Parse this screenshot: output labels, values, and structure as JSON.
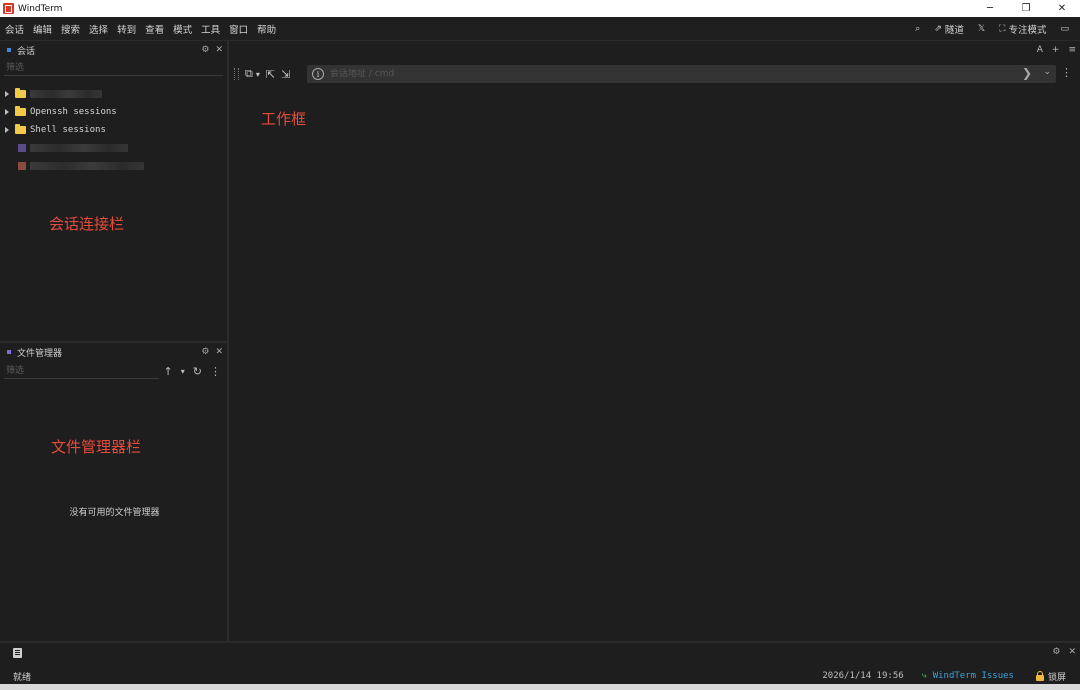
{
  "window": {
    "title": "WindTerm",
    "minimize": "─",
    "restore": "❐",
    "close": "✕"
  },
  "menubar": {
    "items": [
      "会话",
      "编辑",
      "搜索",
      "选择",
      "转到",
      "查看",
      "模式",
      "工具",
      "窗口",
      "帮助"
    ],
    "right": {
      "search_icon": "⌕",
      "tunnel_icon": "⇗",
      "tunnel": "隧道",
      "x": "𝕏",
      "focus_icon": "⛶",
      "focus": "专注模式",
      "layout_icon": "▭"
    }
  },
  "sessions_panel": {
    "title": "会话",
    "gear": "⚙",
    "close": "✕",
    "filter_placeholder": "筛选",
    "folders": [
      "",
      "Openssh sessions",
      "Shell sessions"
    ],
    "session_colors": [
      "#5a4b8a",
      "#8a4b3a"
    ]
  },
  "files_panel": {
    "title": "文件管理器",
    "gear": "⚙",
    "close": "✕",
    "filter_placeholder": "筛选",
    "up": "↑",
    "dropdown": "▾",
    "refresh": "↻",
    "more": "⋮",
    "empty": "没有可用的文件管理器"
  },
  "annotations": {
    "session_bar": "会话连接栏",
    "file_bar": "文件管理器栏",
    "work_area": "工作框"
  },
  "main": {
    "top_tools": [
      "A",
      "+",
      "≡"
    ],
    "toolbar": {
      "new_session": "⧉",
      "dropdown": "▾",
      "open": "⇱",
      "duplicate": "⇲",
      "info": "i",
      "address_placeholder": "会话地址 / cmd",
      "go": "❯",
      "address_dropdown": "⌄",
      "more": "⋮"
    }
  },
  "bottom": {
    "gear": "⚙",
    "close": "✕",
    "status_ready": "就绪",
    "datetime": "2026/1/14 19:56",
    "issues_icon": "⤷",
    "issues": "WindTerm Issues",
    "lock": "锁屏"
  }
}
